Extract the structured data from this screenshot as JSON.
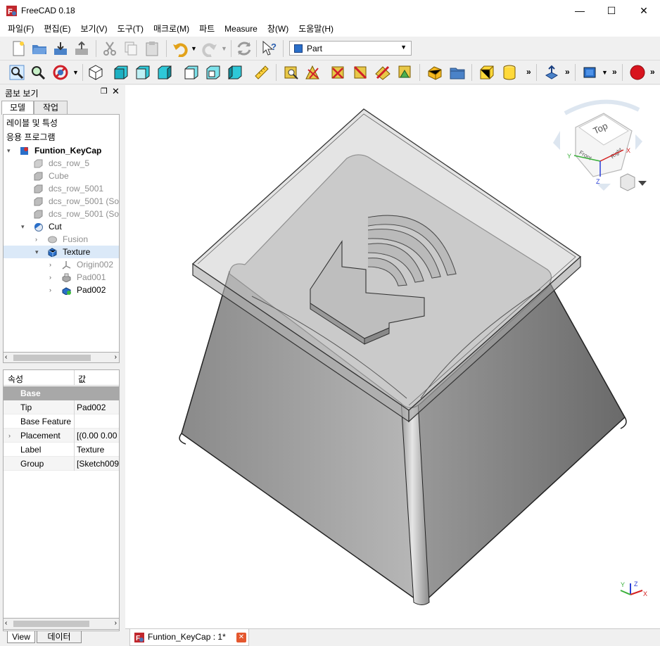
{
  "window": {
    "title": "FreeCAD 0.18",
    "minimize": "—",
    "maximize": "☐",
    "close": "✕"
  },
  "menu": [
    "파일(F)",
    "편집(E)",
    "보기(V)",
    "도구(T)",
    "매크로(M)",
    "파트",
    "Measure",
    "창(W)",
    "도움말(H)"
  ],
  "workbench": {
    "selected": "Part"
  },
  "combo": {
    "title": "콤보 보기",
    "tabs": [
      "모델",
      "작업"
    ]
  },
  "tree": {
    "header1": "레이블 및 특성",
    "header2": "응용 프로그램",
    "items": [
      {
        "label": "Funtion_KeyCap",
        "bold": true
      },
      {
        "label": "dcs_row_5"
      },
      {
        "label": "Cube"
      },
      {
        "label": "dcs_row_5001"
      },
      {
        "label": "dcs_row_5001 (Sol"
      },
      {
        "label": "dcs_row_5001 (Sol"
      },
      {
        "label": "Cut"
      },
      {
        "label": "Fusion"
      },
      {
        "label": "Texture"
      },
      {
        "label": "Origin002"
      },
      {
        "label": "Pad001"
      },
      {
        "label": "Pad002"
      }
    ]
  },
  "properties": {
    "col_property": "속성",
    "col_value": "값",
    "group": "Base",
    "rows": [
      {
        "key": "Tip",
        "value": "Pad002"
      },
      {
        "key": "Base Feature",
        "value": ""
      },
      {
        "key": "Placement",
        "value": "[(0.00 0.00"
      },
      {
        "key": "Label",
        "value": "Texture"
      },
      {
        "key": "Group",
        "value": "[Sketch009"
      }
    ]
  },
  "bottom_tabs": [
    "View",
    "데이터"
  ],
  "document_tab": {
    "label": "Funtion_KeyCap : 1*"
  },
  "navcube": {
    "face": "Top",
    "face_left": "Front",
    "face_right": "Right",
    "axis_x": "X",
    "axis_y": "Y",
    "axis_z": "Z"
  }
}
